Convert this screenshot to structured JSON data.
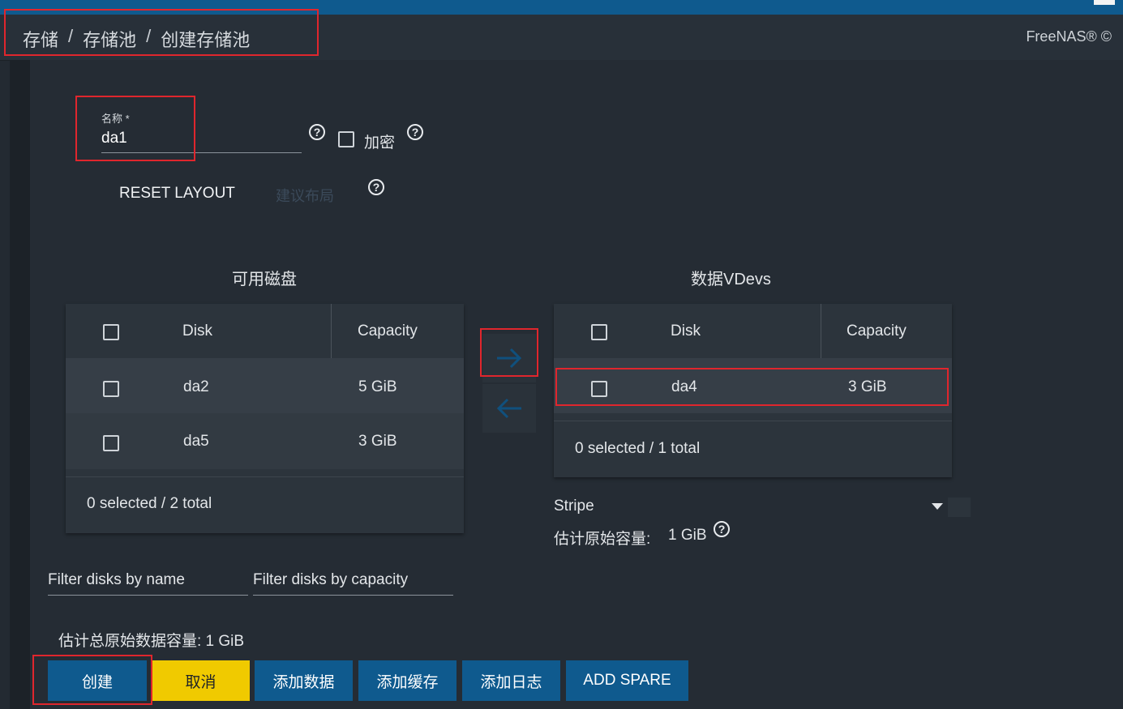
{
  "breadcrumb": [
    "存储",
    "存储池",
    "创建存储池"
  ],
  "brand": "FreeNAS® ©",
  "form": {
    "name_label": "名称 *",
    "name_value": "da1",
    "encrypt_label": "加密",
    "reset_layout": "RESET LAYOUT",
    "suggest_layout": "建议布局"
  },
  "available": {
    "title": "可用磁盘",
    "col_disk": "Disk",
    "col_capacity": "Capacity",
    "rows": [
      {
        "disk": "da2",
        "capacity": "5 GiB"
      },
      {
        "disk": "da5",
        "capacity": "3 GiB"
      }
    ],
    "footer": "0 selected / 2 total"
  },
  "vdevs": {
    "title": "数据VDevs",
    "col_disk": "Disk",
    "col_capacity": "Capacity",
    "rows": [
      {
        "disk": "da4",
        "capacity": "3 GiB"
      }
    ],
    "footer": "0 selected / 1 total",
    "layout_value": "Stripe",
    "est_label": "估计原始容量:",
    "est_value": "1 GiB"
  },
  "filters": {
    "by_name": "Filter disks by name",
    "by_capacity": "Filter disks by capacity"
  },
  "total_estimate": "估计总原始数据容量: 1 GiB",
  "buttons": {
    "create": "创建",
    "cancel": "取消",
    "add_data": "添加数据",
    "add_cache": "添加缓存",
    "add_log": "添加日志",
    "add_spare": "ADD SPARE"
  },
  "icons": {
    "move_right": "arrow-right-icon",
    "move_left": "arrow-left-icon",
    "help": "help-circle-icon",
    "dropdown": "caret-down-icon"
  },
  "colors": {
    "primary": "#0f5a8e",
    "cancel": "#f0ca00",
    "background": "#232a32"
  }
}
